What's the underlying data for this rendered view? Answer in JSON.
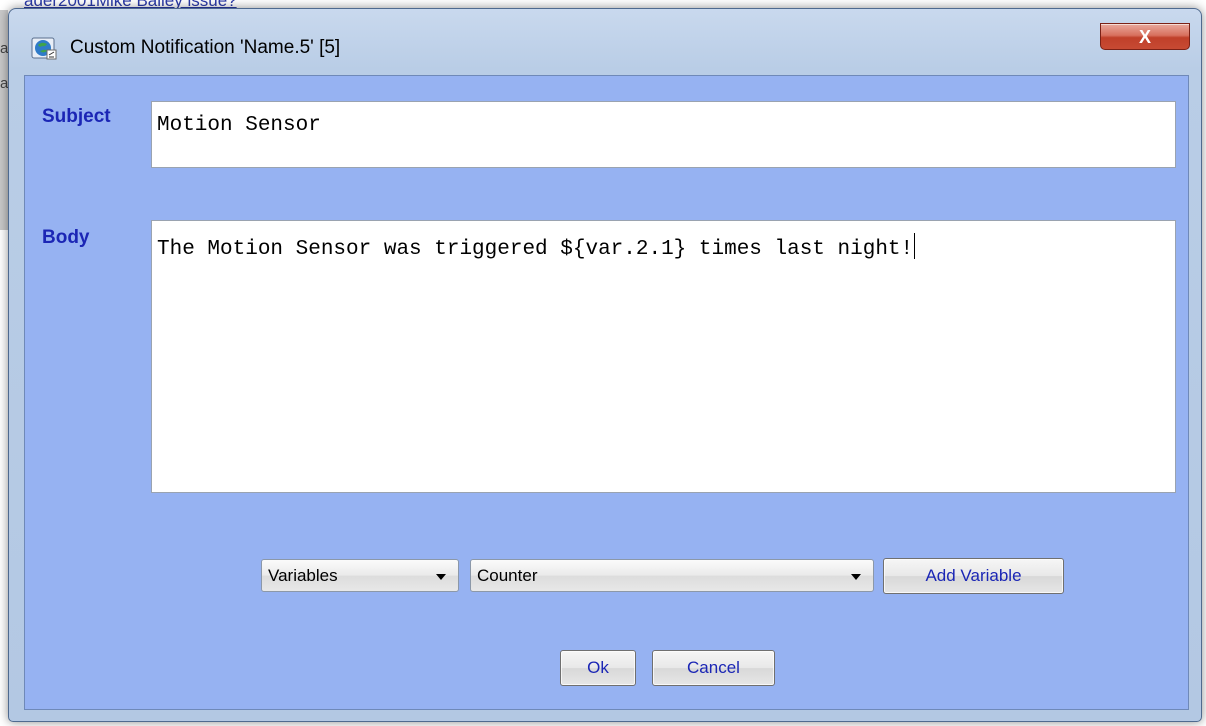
{
  "background": {
    "link_text": "ader2001Mike Bailey issue?",
    "strip_chars": [
      "a",
      "a"
    ]
  },
  "window": {
    "title": "Custom Notification 'Name.5' [5]",
    "close_glyph": "X"
  },
  "form": {
    "subject_label": "Subject",
    "subject_value": "Motion Sensor",
    "body_label": "Body",
    "body_value": "The Motion Sensor was triggered ${var.2.1} times last night!"
  },
  "variables": {
    "type_select_value": "Variables",
    "variable_select_value": "Counter",
    "add_button_label": "Add Variable"
  },
  "actions": {
    "ok_label": "Ok",
    "cancel_label": "Cancel"
  },
  "colors": {
    "client_background": "#96b2f2",
    "label_color": "#1b26b5",
    "close_button": "#c74a33"
  },
  "icons": {
    "app_icon": "globe-icon",
    "dropdown_arrow": "chevron-down-icon"
  }
}
